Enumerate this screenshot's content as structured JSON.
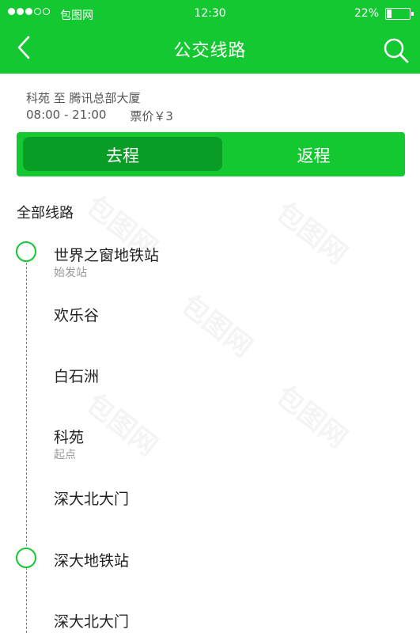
{
  "status_bar": {
    "carrier": "包图网",
    "time": "12:30",
    "battery_percent": "22%",
    "battery_level": 0.22
  },
  "header": {
    "title": "公交线路",
    "back_icon": "chevron-left-icon",
    "search_icon": "search-icon",
    "color": "#14c832"
  },
  "route": {
    "name": "科苑 至 腾讯总部大厦",
    "hours": "08:00 - 21:00",
    "fare": "票价￥3"
  },
  "direction_tabs": {
    "outbound": "去程",
    "return": "返程",
    "selected": "outbound"
  },
  "section_title": "全部线路",
  "stops": [
    {
      "name": "世界之窗地铁站",
      "note": "始发站",
      "marker": true
    },
    {
      "name": "欢乐谷",
      "note": "",
      "marker": false
    },
    {
      "name": "白石洲",
      "note": "",
      "marker": false
    },
    {
      "name": "科苑",
      "note": "起点",
      "marker": false
    },
    {
      "name": "深大北大门",
      "note": "",
      "marker": false
    },
    {
      "name": "深大地铁站",
      "note": "",
      "marker": true
    },
    {
      "name": "深大北大门",
      "note": "",
      "marker": false
    }
  ],
  "watermark": "包图网"
}
